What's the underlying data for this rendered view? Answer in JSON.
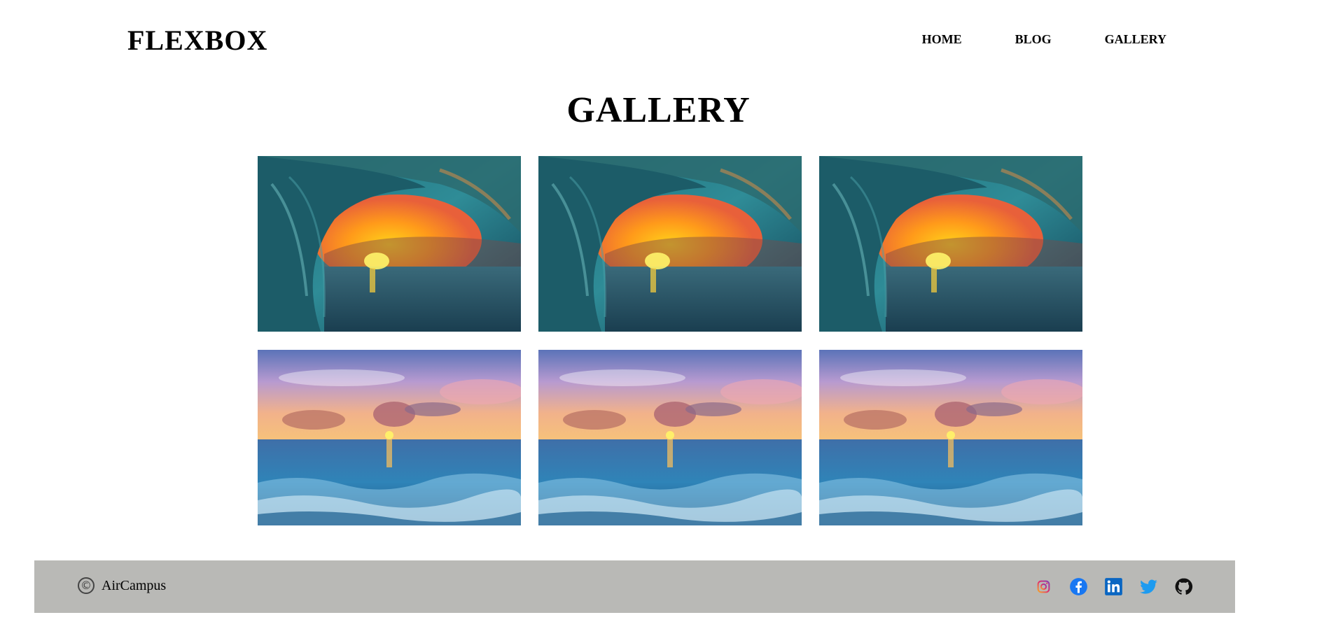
{
  "header": {
    "logo": "FLEXBOX",
    "nav": [
      {
        "label": "HOME"
      },
      {
        "label": "BLOG"
      },
      {
        "label": "GALLERY"
      }
    ]
  },
  "main": {
    "title": "GALLERY",
    "images": [
      {
        "scene": "wave-tunnel-sunset"
      },
      {
        "scene": "wave-tunnel-sunset"
      },
      {
        "scene": "wave-tunnel-sunset"
      },
      {
        "scene": "beach-sunset"
      },
      {
        "scene": "beach-sunset"
      },
      {
        "scene": "beach-sunset"
      }
    ]
  },
  "footer": {
    "copyright_symbol": "©",
    "copyright_text": "AirCampus",
    "socials": [
      "instagram-icon",
      "facebook-icon",
      "linkedin-icon",
      "twitter-icon",
      "github-icon"
    ]
  },
  "colors": {
    "footer_bg": "#b9b9b6",
    "facebook": "#1877f2",
    "linkedin": "#0a66c2",
    "twitter": "#1d9bf0",
    "github": "#000000"
  }
}
